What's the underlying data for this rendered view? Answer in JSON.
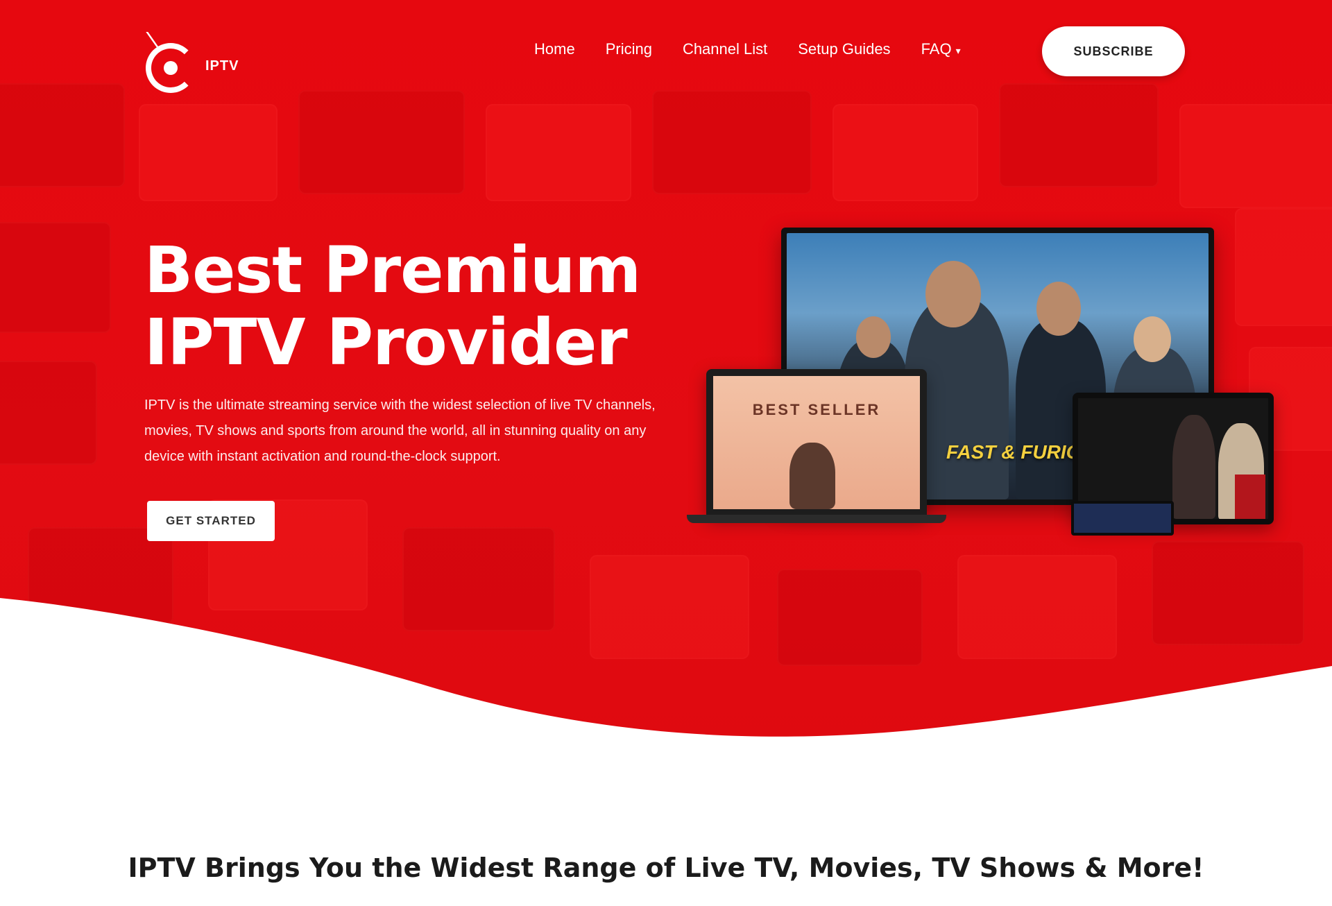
{
  "brand": {
    "logo_text": "IPTV",
    "accent_color": "#e30b12"
  },
  "nav": {
    "items": [
      {
        "label": "Home",
        "has_dropdown": false
      },
      {
        "label": "Pricing",
        "has_dropdown": false
      },
      {
        "label": "Channel List",
        "has_dropdown": false
      },
      {
        "label": "Setup Guides",
        "has_dropdown": false
      },
      {
        "label": "FAQ",
        "has_dropdown": true
      }
    ],
    "cta_label": "SUBSCRIBE",
    "dropdown_icon": "chevron-down-icon"
  },
  "hero": {
    "title_line1": "Best Premium",
    "title_line2": "IPTV Provider",
    "description": "IPTV is the ultimate streaming service with the widest selection of live TV channels, movies, TV shows and sports from around the world, all in stunning quality on any device with instant activation and round-the-clock support.",
    "button_label": "GET STARTED"
  },
  "devices": {
    "tv_logo": "FAST & FURIOUS",
    "laptop_title": "BEST SELLER"
  },
  "section": {
    "tagline": "IPTV Brings You the Widest Range of Live TV, Movies, TV Shows & More!"
  }
}
